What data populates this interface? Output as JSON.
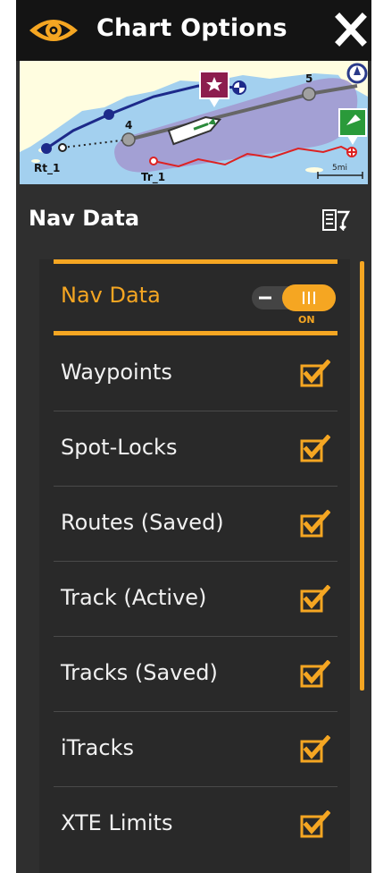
{
  "header": {
    "title": "Chart Options",
    "eye_icon": "eye-icon",
    "close_icon": "close-icon"
  },
  "map": {
    "route_label": "Rt_1",
    "track_label": "Tr_1",
    "waypoint_4": "4",
    "waypoint_5": "5",
    "scale_label": "5mi",
    "icons": [
      "star-waypoint-icon",
      "flag-waypoint-icon",
      "boat-icon",
      "compass-icon"
    ]
  },
  "section": {
    "title": "Nav Data",
    "menu_icon": "list-menu-icon"
  },
  "nav_toggle": {
    "label": "Nav Data",
    "state_label": "ON"
  },
  "items": [
    {
      "label": "Waypoints",
      "checked": true
    },
    {
      "label": "Spot-Locks",
      "checked": true
    },
    {
      "label": "Routes (Saved)",
      "checked": true
    },
    {
      "label": "Track (Active)",
      "checked": true
    },
    {
      "label": "Tracks (Saved)",
      "checked": true
    },
    {
      "label": "iTracks",
      "checked": true
    },
    {
      "label": "XTE Limits",
      "checked": true
    }
  ],
  "colors": {
    "accent": "#f5a622",
    "header_bg": "#141414",
    "panel_bg": "#2f2f2f",
    "water": "#a3d0ef",
    "land": "#fffde0",
    "route_zone": "#a39ad0"
  }
}
